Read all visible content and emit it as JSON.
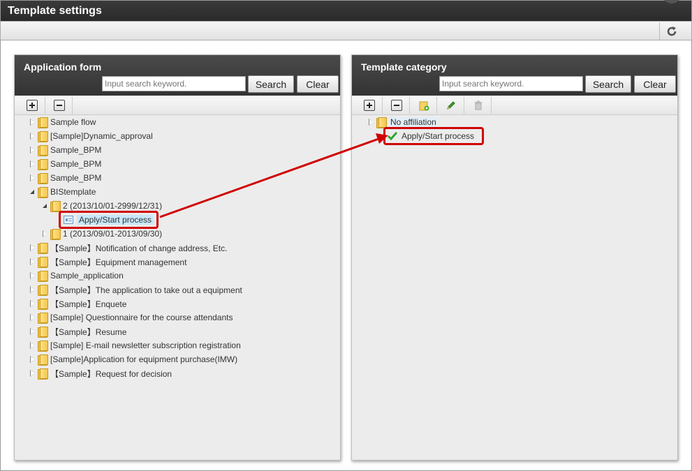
{
  "window": {
    "title": "Template settings"
  },
  "toolbar": {
    "refresh_icon": "refresh-icon"
  },
  "left_panel": {
    "title": "Application form",
    "search_placeholder": "Input search keyword.",
    "search_label": "Search",
    "clear_label": "Clear",
    "tree": [
      {
        "label": "Sample flow"
      },
      {
        "label": "[Sample]Dynamic_approval"
      },
      {
        "label": "Sample_BPM"
      },
      {
        "label": "Sample_BPM"
      },
      {
        "label": "Sample_BPM"
      },
      {
        "label": "BIStemplate"
      },
      {
        "label": "2 (2013/10/01-2999/12/31)"
      },
      {
        "label": "Apply/Start process"
      },
      {
        "label": "1 (2013/09/01-2013/09/30)"
      },
      {
        "label": "【Sample】Notification of change address, Etc."
      },
      {
        "label": "【Sample】Equipment management"
      },
      {
        "label": "Sample_application"
      },
      {
        "label": "【Sample】The application to take out a equipment"
      },
      {
        "label": "【Sample】Enquete"
      },
      {
        "label": "[Sample] Questionnaire for the course attendants"
      },
      {
        "label": "【Sample】Resume"
      },
      {
        "label": "[Sample] E-mail newsletter subscription registration"
      },
      {
        "label": "[Sample]Application for equipment purchase(IMW)"
      },
      {
        "label": "【Sample】Request for decision"
      }
    ]
  },
  "right_panel": {
    "title": "Template category",
    "search_placeholder": "Input search keyword.",
    "search_label": "Search",
    "clear_label": "Clear",
    "tree": [
      {
        "label": "No affiliation"
      },
      {
        "label": "Apply/Start process"
      }
    ]
  },
  "colors": {
    "highlight": "#d00000",
    "selection": "#c9e7fb",
    "header": "#3a3a3a"
  }
}
